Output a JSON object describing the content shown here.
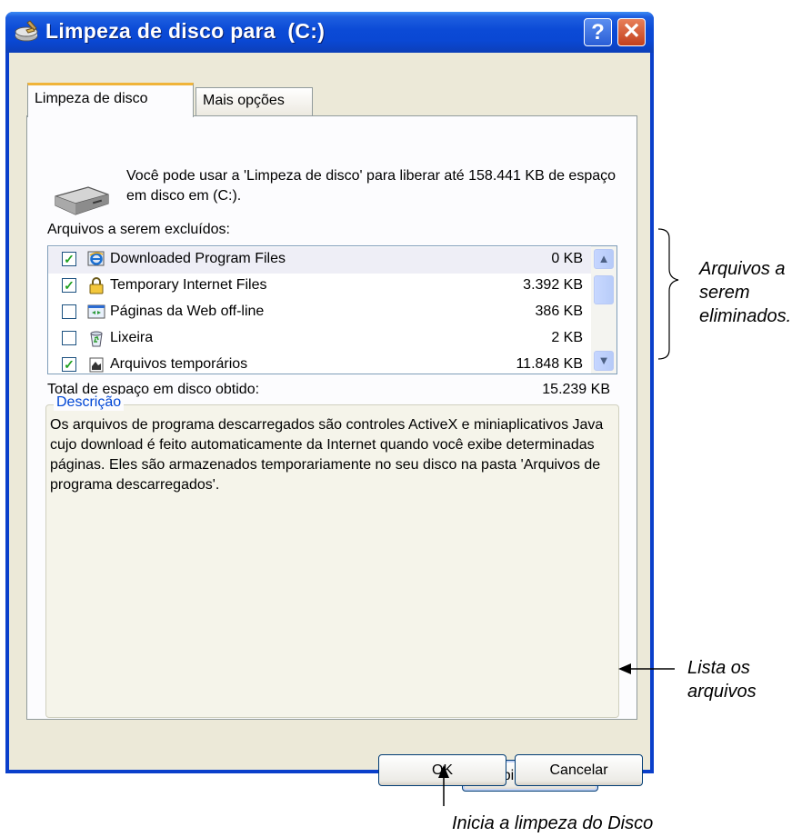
{
  "window": {
    "title": "Limpeza de disco para  (C:)"
  },
  "titlebar_buttons": {
    "help": "?",
    "close": "✕"
  },
  "tabs": [
    {
      "label": "Limpeza de disco",
      "active": true
    },
    {
      "label": "Mais opções",
      "active": false
    }
  ],
  "intro_text": "Você pode usar a 'Limpeza de disco' para liberar até 158.441 KB de espaço em disco em  (C:).",
  "files_label": "Arquivos a serem excluídos:",
  "files": [
    {
      "name": "Downloaded Program Files",
      "size": "0 KB",
      "checked": true,
      "icon": "ie-download-icon"
    },
    {
      "name": "Temporary Internet Files",
      "size": "3.392 KB",
      "checked": true,
      "icon": "lock-icon"
    },
    {
      "name": "Páginas da Web off-line",
      "size": "386 KB",
      "checked": false,
      "icon": "offline-pages-icon"
    },
    {
      "name": "Lixeira",
      "size": "2 KB",
      "checked": false,
      "icon": "recycle-bin-icon"
    },
    {
      "name": "Arquivos temporários",
      "size": "11.848 KB",
      "checked": true,
      "icon": "temp-files-icon"
    }
  ],
  "total": {
    "label": "Total de espaço em disco obtido:",
    "value": "15.239 KB"
  },
  "description": {
    "legend": "Descrição",
    "text": "Os arquivos de programa descarregados são controles ActiveX e miniaplicativos Java cujo download é feito automaticamente da Internet quando você exibe determinadas páginas. Eles são armazenados temporariamente no seu disco na pasta 'Arquivos de programa descarregados'."
  },
  "buttons": {
    "view_files": "Exibir arquivos",
    "ok": "OK",
    "cancel": "Cancelar"
  },
  "annotations": {
    "files_note": "Arquivos a serem eliminados.",
    "list_note": "Lista os arquivos",
    "start_note": "Inicia a limpeza do Disco"
  },
  "colors": {
    "titlebar": "#0a48d4",
    "dialog_bg": "#ece9d8",
    "tab_accent": "#f0b43a",
    "check": "#21a121"
  }
}
